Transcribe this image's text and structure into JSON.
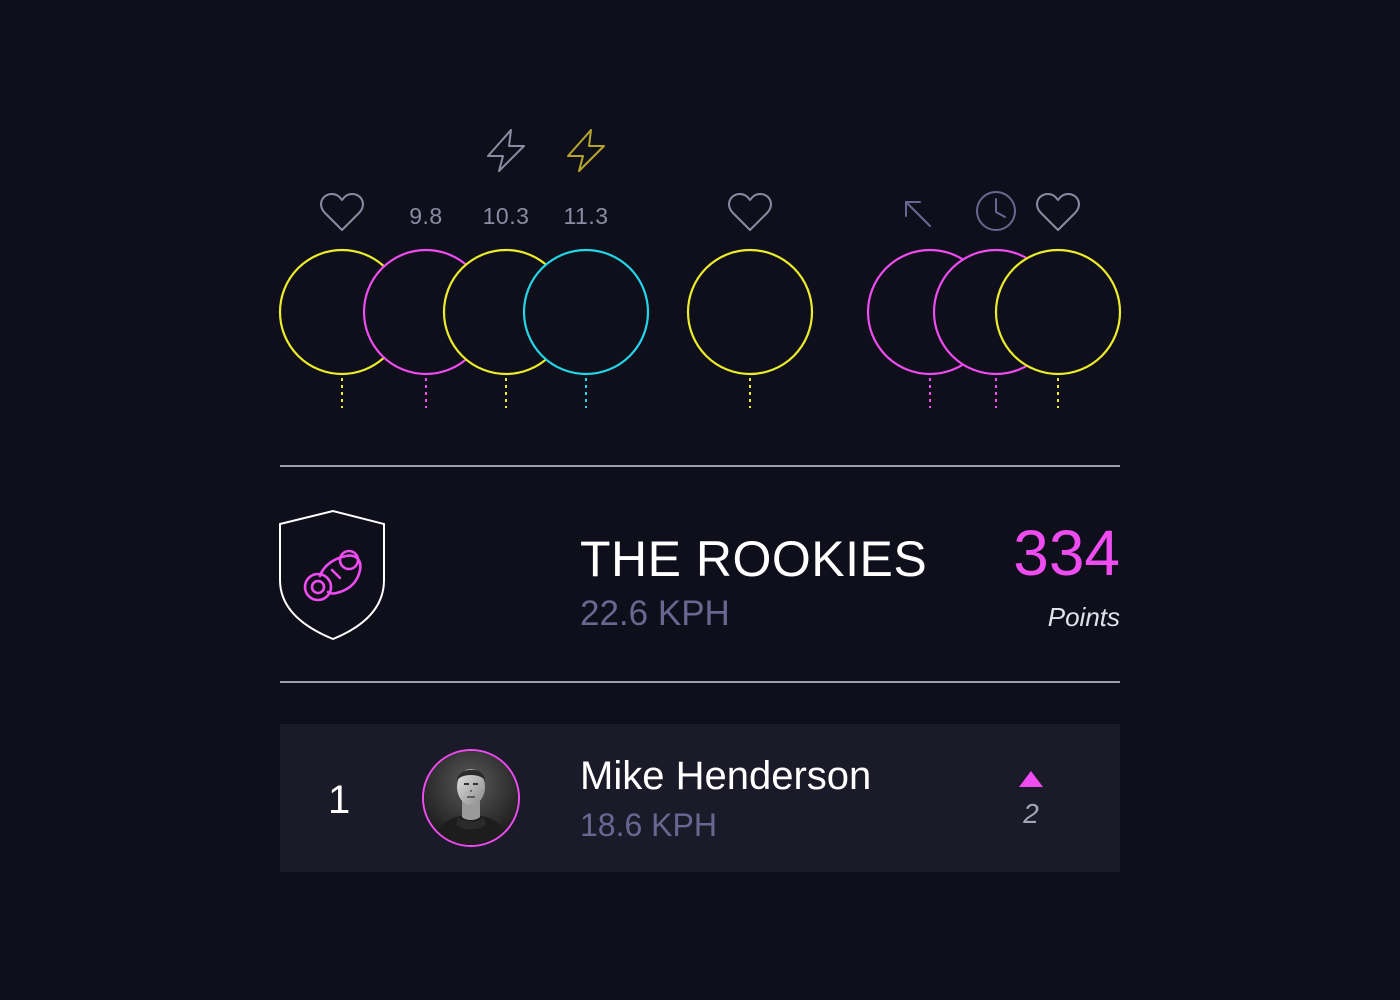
{
  "colors": {
    "background": "#0f0f1b",
    "yellow": "#ecec2d",
    "magenta": "#ee4cf0",
    "cyan": "#25d4e6",
    "icon_gray": "#8d8ba3",
    "icon_olive": "#b6a52c",
    "icon_purple": "#6b6691",
    "row_bg": "#1b1a29"
  },
  "track": {
    "markers": [
      {
        "color": "yellow",
        "icon": "heart-icon",
        "value": ""
      },
      {
        "color": "magenta",
        "icon": "",
        "value": "9.8"
      },
      {
        "color": "yellow",
        "icon": "lightning-icon",
        "value": "10.3"
      },
      {
        "color": "cyan",
        "icon": "lightning-icon",
        "value": "11.3"
      },
      {
        "color": "yellow",
        "icon": "heart-icon",
        "value": ""
      },
      {
        "color": "magenta",
        "icon": "arrow-up-left-icon",
        "value": ""
      },
      {
        "color": "magenta",
        "icon": "clock-icon",
        "value": ""
      },
      {
        "color": "yellow",
        "icon": "heart-icon",
        "value": ""
      }
    ]
  },
  "team": {
    "icon": "pacifier-shield-icon",
    "name": "THE ROOKIES",
    "speed": "22.6 KPH",
    "points": "334",
    "points_label": "Points"
  },
  "leaderboard": [
    {
      "rank": "1",
      "avatar": "avatar-photo",
      "name": "Mike Henderson",
      "speed": "18.6 KPH",
      "trend_icon": "triangle-up-icon",
      "trend_value": "2"
    }
  ]
}
